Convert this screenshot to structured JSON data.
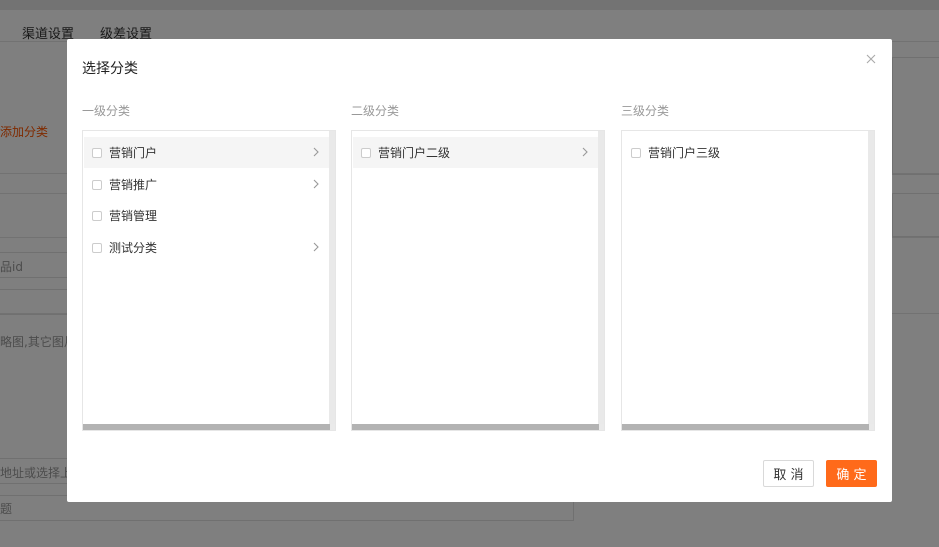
{
  "background": {
    "tabs": [
      "渠道设置",
      "级差设置"
    ],
    "add_category_link": "添加分类",
    "field_product_id": "品id",
    "field_thumbnail_hint": "略图,其它图片",
    "field_address_hint": "地址或选择上",
    "field_title_hint": "题"
  },
  "dialog": {
    "title": "选择分类",
    "close_icon": "close-icon",
    "columns": [
      {
        "label": "一级分类",
        "items": [
          {
            "label": "营销门户",
            "has_children": true,
            "active": true
          },
          {
            "label": "营销推广",
            "has_children": true,
            "active": false
          },
          {
            "label": "营销管理",
            "has_children": false,
            "active": false
          },
          {
            "label": "测试分类",
            "has_children": true,
            "active": false
          }
        ]
      },
      {
        "label": "二级分类",
        "items": [
          {
            "label": "营销门户二级",
            "has_children": true,
            "active": true
          }
        ]
      },
      {
        "label": "三级分类",
        "items": [
          {
            "label": "营销门户三级",
            "has_children": false,
            "active": false
          }
        ]
      }
    ],
    "cancel_label": "取 消",
    "ok_label": "确 定"
  },
  "colors": {
    "accent": "#ff6a1a",
    "link_orange": "#ff5500",
    "overlay": "rgba(0,0,0,0.5)"
  }
}
